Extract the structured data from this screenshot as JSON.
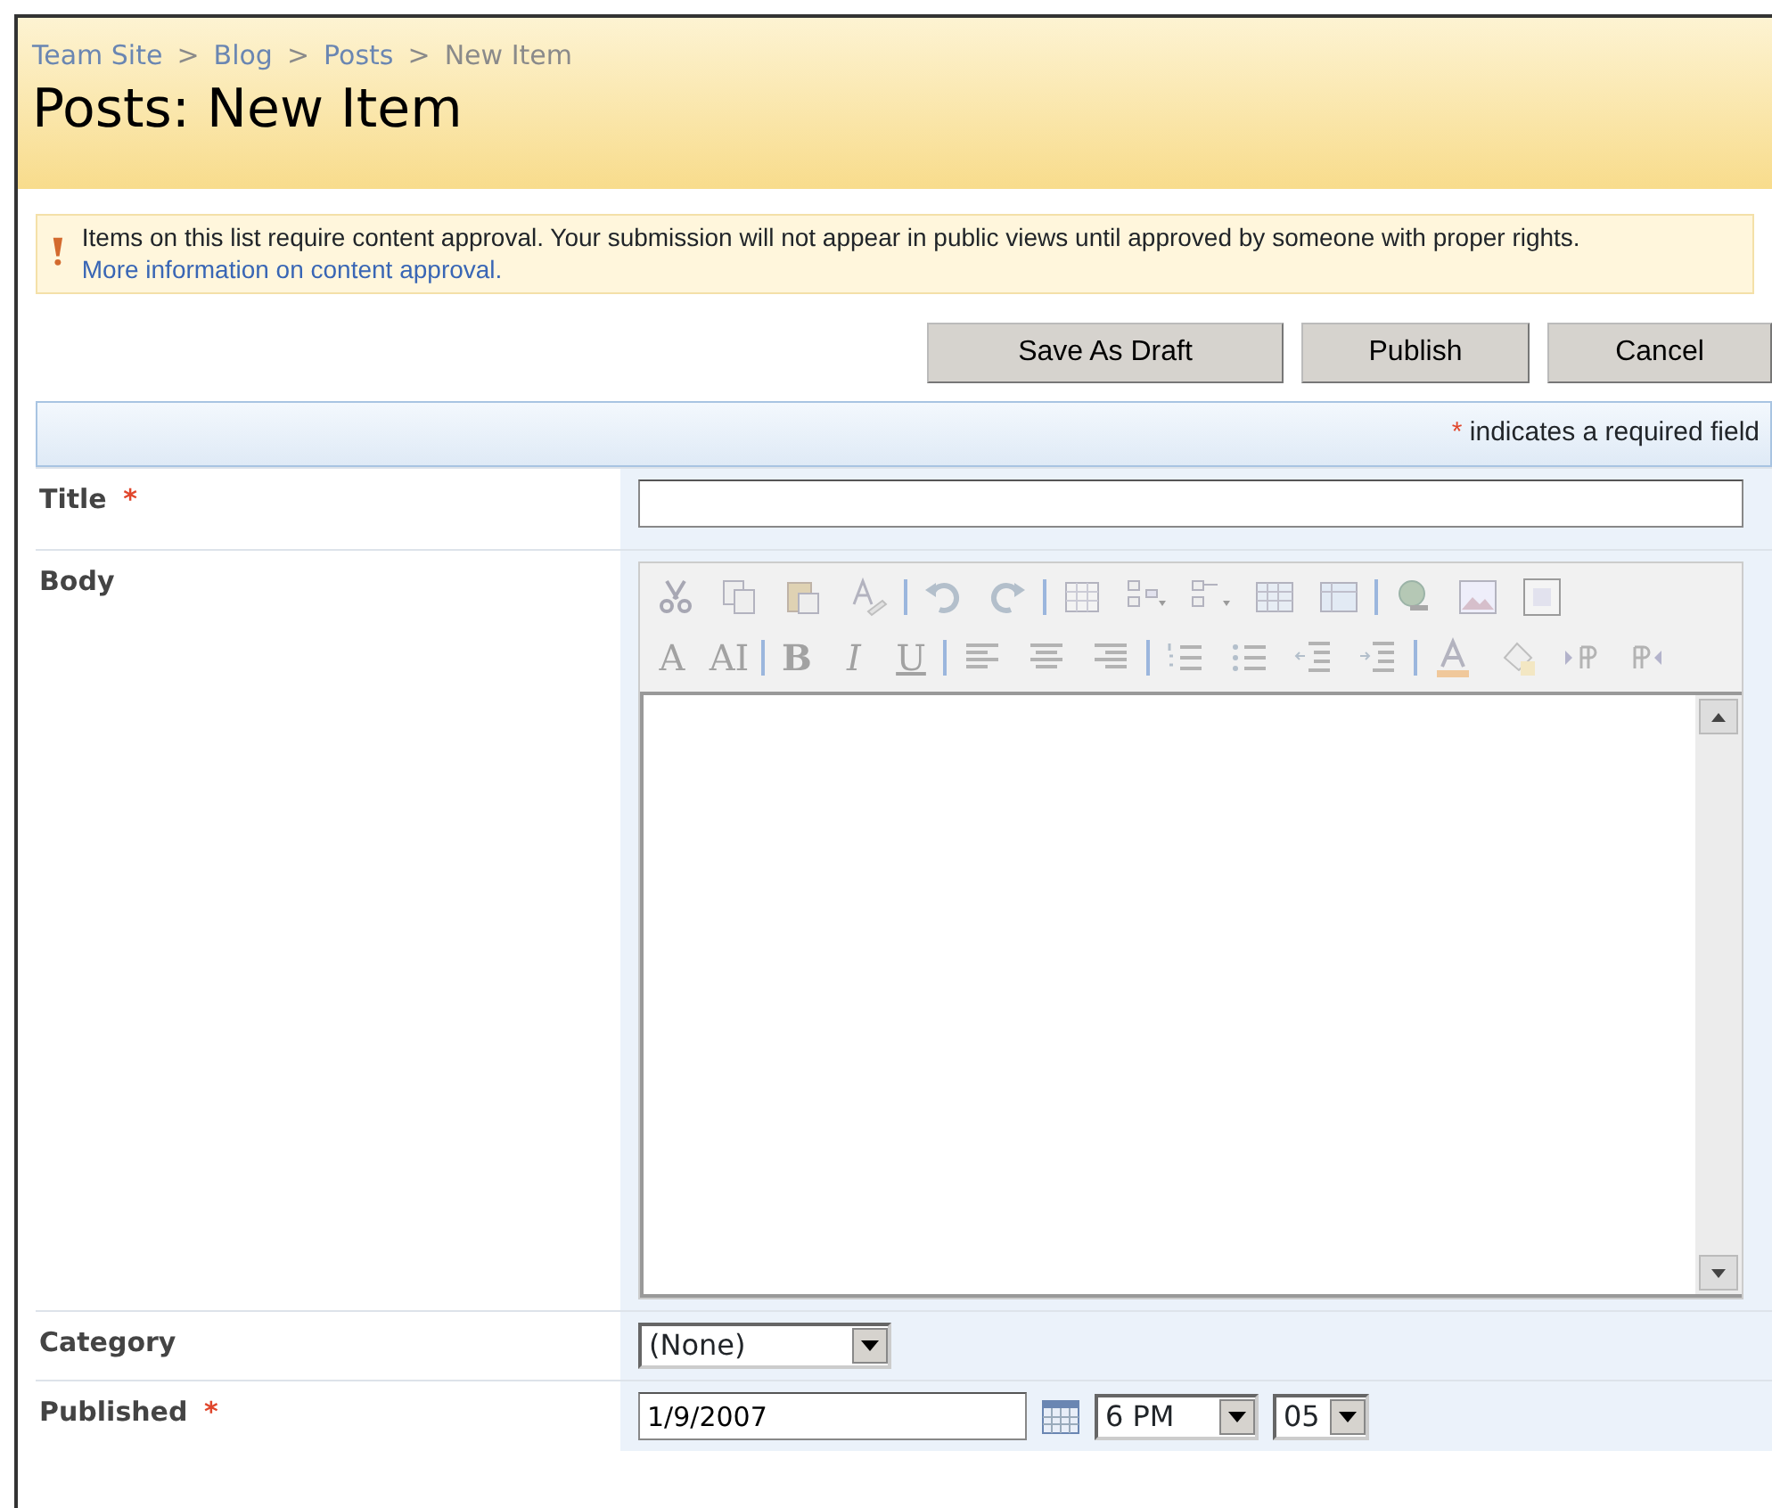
{
  "breadcrumb": [
    {
      "label": "Team Site",
      "current": false
    },
    {
      "label": "Blog",
      "current": false
    },
    {
      "label": "Posts",
      "current": false
    },
    {
      "label": "New Item",
      "current": true
    }
  ],
  "breadcrumb_separator": ">",
  "page_title": "Posts: New Item",
  "notice": {
    "text": "Items on this list require content approval. Your submission will not appear in public views until approved by someone with proper rights.",
    "link": "More information on content approval."
  },
  "buttons": [
    "Save As Draft",
    "Publish",
    "Cancel"
  ],
  "required_note": {
    "mark": "*",
    "text": "indicates a required field"
  },
  "fields": [
    {
      "label": "Title",
      "required": true,
      "kind": "text"
    },
    {
      "label": "Body",
      "required": false,
      "kind": "richtext"
    },
    {
      "label": "Category",
      "required": false,
      "kind": "select",
      "value": "(None)"
    },
    {
      "label": "Published",
      "required": true,
      "kind": "datetime",
      "date": "1/9/2007",
      "hour": "6 PM",
      "minute": "05"
    }
  ],
  "required_mark": "*",
  "toolbar": {
    "disabled": true,
    "rows": [
      [
        {
          "kind": "cut"
        },
        {
          "kind": "copy"
        },
        {
          "kind": "paste"
        },
        {
          "kind": "spell"
        },
        {
          "kind": "sep"
        },
        {
          "kind": "undo"
        },
        {
          "kind": "redo"
        },
        {
          "kind": "sep"
        },
        {
          "kind": "table"
        },
        {
          "kind": "tablemenu"
        },
        {
          "kind": "treemenu"
        },
        {
          "kind": "grid"
        },
        {
          "kind": "panel"
        },
        {
          "kind": "sep"
        },
        {
          "kind": "link"
        },
        {
          "kind": "image"
        },
        {
          "kind": "frame"
        }
      ],
      [
        {
          "kind": "glyph",
          "text": "A"
        },
        {
          "kind": "glyph",
          "text": "AI"
        },
        {
          "kind": "sep"
        },
        {
          "kind": "bold",
          "text": "B"
        },
        {
          "kind": "italic",
          "text": "I"
        },
        {
          "kind": "underline",
          "text": "U"
        },
        {
          "kind": "sep"
        },
        {
          "kind": "alignleft"
        },
        {
          "kind": "aligncenter"
        },
        {
          "kind": "alignright"
        },
        {
          "kind": "sep"
        },
        {
          "kind": "numbered"
        },
        {
          "kind": "bullets"
        },
        {
          "kind": "outdent"
        },
        {
          "kind": "indent"
        },
        {
          "kind": "sep"
        },
        {
          "kind": "fontcolor"
        },
        {
          "kind": "highlight"
        },
        {
          "kind": "ltr"
        },
        {
          "kind": "rtl"
        }
      ]
    ]
  }
}
